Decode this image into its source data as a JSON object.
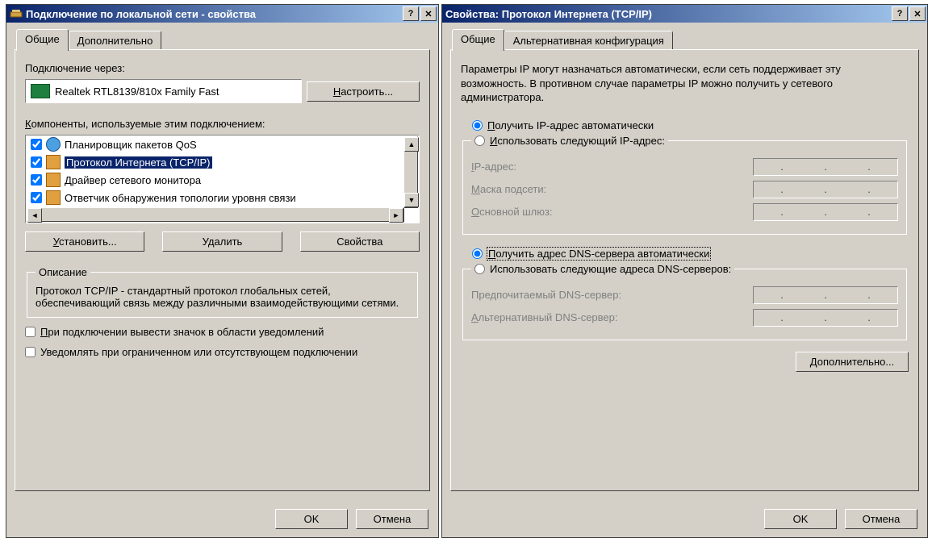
{
  "left": {
    "title": "Подключение по локальной сети - свойства",
    "tabs": {
      "general": "Общие",
      "advanced": "Дополнительно"
    },
    "connect_via_label": "Подключение через:",
    "adapter_name": "Realtek RTL8139/810x Family Fast",
    "configure_btn": "Настроить...",
    "components_label": "Компоненты, используемые этим подключением:",
    "items": [
      {
        "label": "Планировщик пакетов QoS",
        "selected": false,
        "icon": "globe"
      },
      {
        "label": "Протокол Интернета (TCP/IP)",
        "selected": true,
        "icon": "net"
      },
      {
        "label": "Драйвер сетевого монитора",
        "selected": false,
        "icon": "net"
      },
      {
        "label": "Ответчик обнаружения топологии уровня связи",
        "selected": false,
        "icon": "net"
      }
    ],
    "install_btn": "Установить...",
    "remove_btn": "Удалить",
    "properties_btn": "Свойства",
    "description_header": "Описание",
    "description_text": "Протокол TCP/IP - стандартный протокол глобальных сетей, обеспечивающий связь между различными взаимодействующими сетями.",
    "notify_checkbox": "При подключении вывести значок в области уведомлений",
    "limited_checkbox": "Уведомлять при ограниченном или отсутствующем подключении",
    "ok": "OK",
    "cancel": "Отмена"
  },
  "right": {
    "title": "Свойства: Протокол Интернета (TCP/IP)",
    "tabs": {
      "general": "Общие",
      "altconfig": "Альтернативная конфигурация"
    },
    "intro": "Параметры IP могут назначаться автоматически, если сеть поддерживает эту возможность. В противном случае параметры IP можно получить у сетевого администратора.",
    "radio_obtain_ip": "Получить IP-адрес автоматически",
    "radio_use_ip": "Использовать следующий IP-адрес:",
    "ip_label": "IP-адрес:",
    "mask_label": "Маска подсети:",
    "gateway_label": "Основной шлюз:",
    "radio_obtain_dns": "Получить адрес DNS-сервера автоматически",
    "radio_use_dns": "Использовать следующие адреса DNS-серверов:",
    "dns_pref_label": "Предпочитаемый DNS-сервер:",
    "dns_alt_label": "Альтернативный DNS-сервер:",
    "advanced_btn": "Дополнительно...",
    "ok": "OK",
    "cancel": "Отмена"
  }
}
